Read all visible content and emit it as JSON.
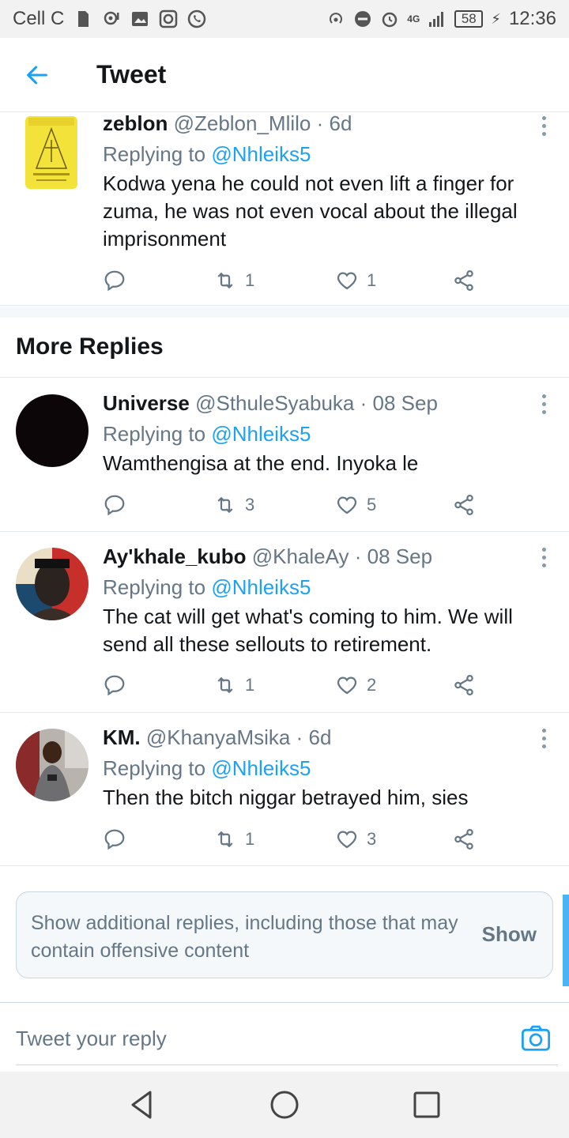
{
  "status_bar": {
    "carrier": "Cell C",
    "network": "4G",
    "battery": "58",
    "time": "12:36"
  },
  "header": {
    "title": "Tweet"
  },
  "top_reply": {
    "name": "zeblon",
    "handle": "@Zeblon_Mlilo",
    "time": "6d",
    "replying_prefix": "Replying to",
    "replying_to": "@Nhleiks5",
    "text": "Kodwa yena he could not even lift a finger for zuma, he was not even vocal about the illegal imprisonment",
    "retweets": "1",
    "likes": "1"
  },
  "more_replies": {
    "heading": "More Replies",
    "items": [
      {
        "name": "Universe",
        "handle": "@SthuleSyabuka",
        "time": "08 Sep",
        "replying_prefix": "Replying to",
        "replying_to": "@Nhleiks5",
        "text": "Wamthengisa at the end. Inyoka le",
        "retweets": "3",
        "likes": "5"
      },
      {
        "name": "Ay'khale_kubo",
        "handle": "@KhaleAy",
        "time": "08 Sep",
        "replying_prefix": "Replying to",
        "replying_to": "@Nhleiks5",
        "text": "The cat will get what's coming to him. We will send all these sellouts to retirement.",
        "retweets": "1",
        "likes": "2"
      },
      {
        "name": "KM.",
        "handle": "@KhanyaMsika",
        "time": "6d",
        "replying_prefix": "Replying to",
        "replying_to": "@Nhleiks5",
        "text": "Then the bitch niggar betrayed him, sies",
        "retweets": "1",
        "likes": "3"
      }
    ]
  },
  "additional_replies": {
    "message": "Show additional replies, including those that may contain offensive content",
    "button": "Show"
  },
  "reply_bar": {
    "placeholder": "Tweet your reply"
  },
  "colors": {
    "accent": "#1da1f2",
    "text_secondary": "#657786",
    "divider": "#e1e8ed"
  },
  "icons": [
    "back-arrow-icon",
    "more-icon",
    "reply-icon",
    "retweet-icon",
    "like-icon",
    "share-icon",
    "camera-icon",
    "nav-back-icon",
    "nav-home-icon",
    "nav-recents-icon"
  ]
}
